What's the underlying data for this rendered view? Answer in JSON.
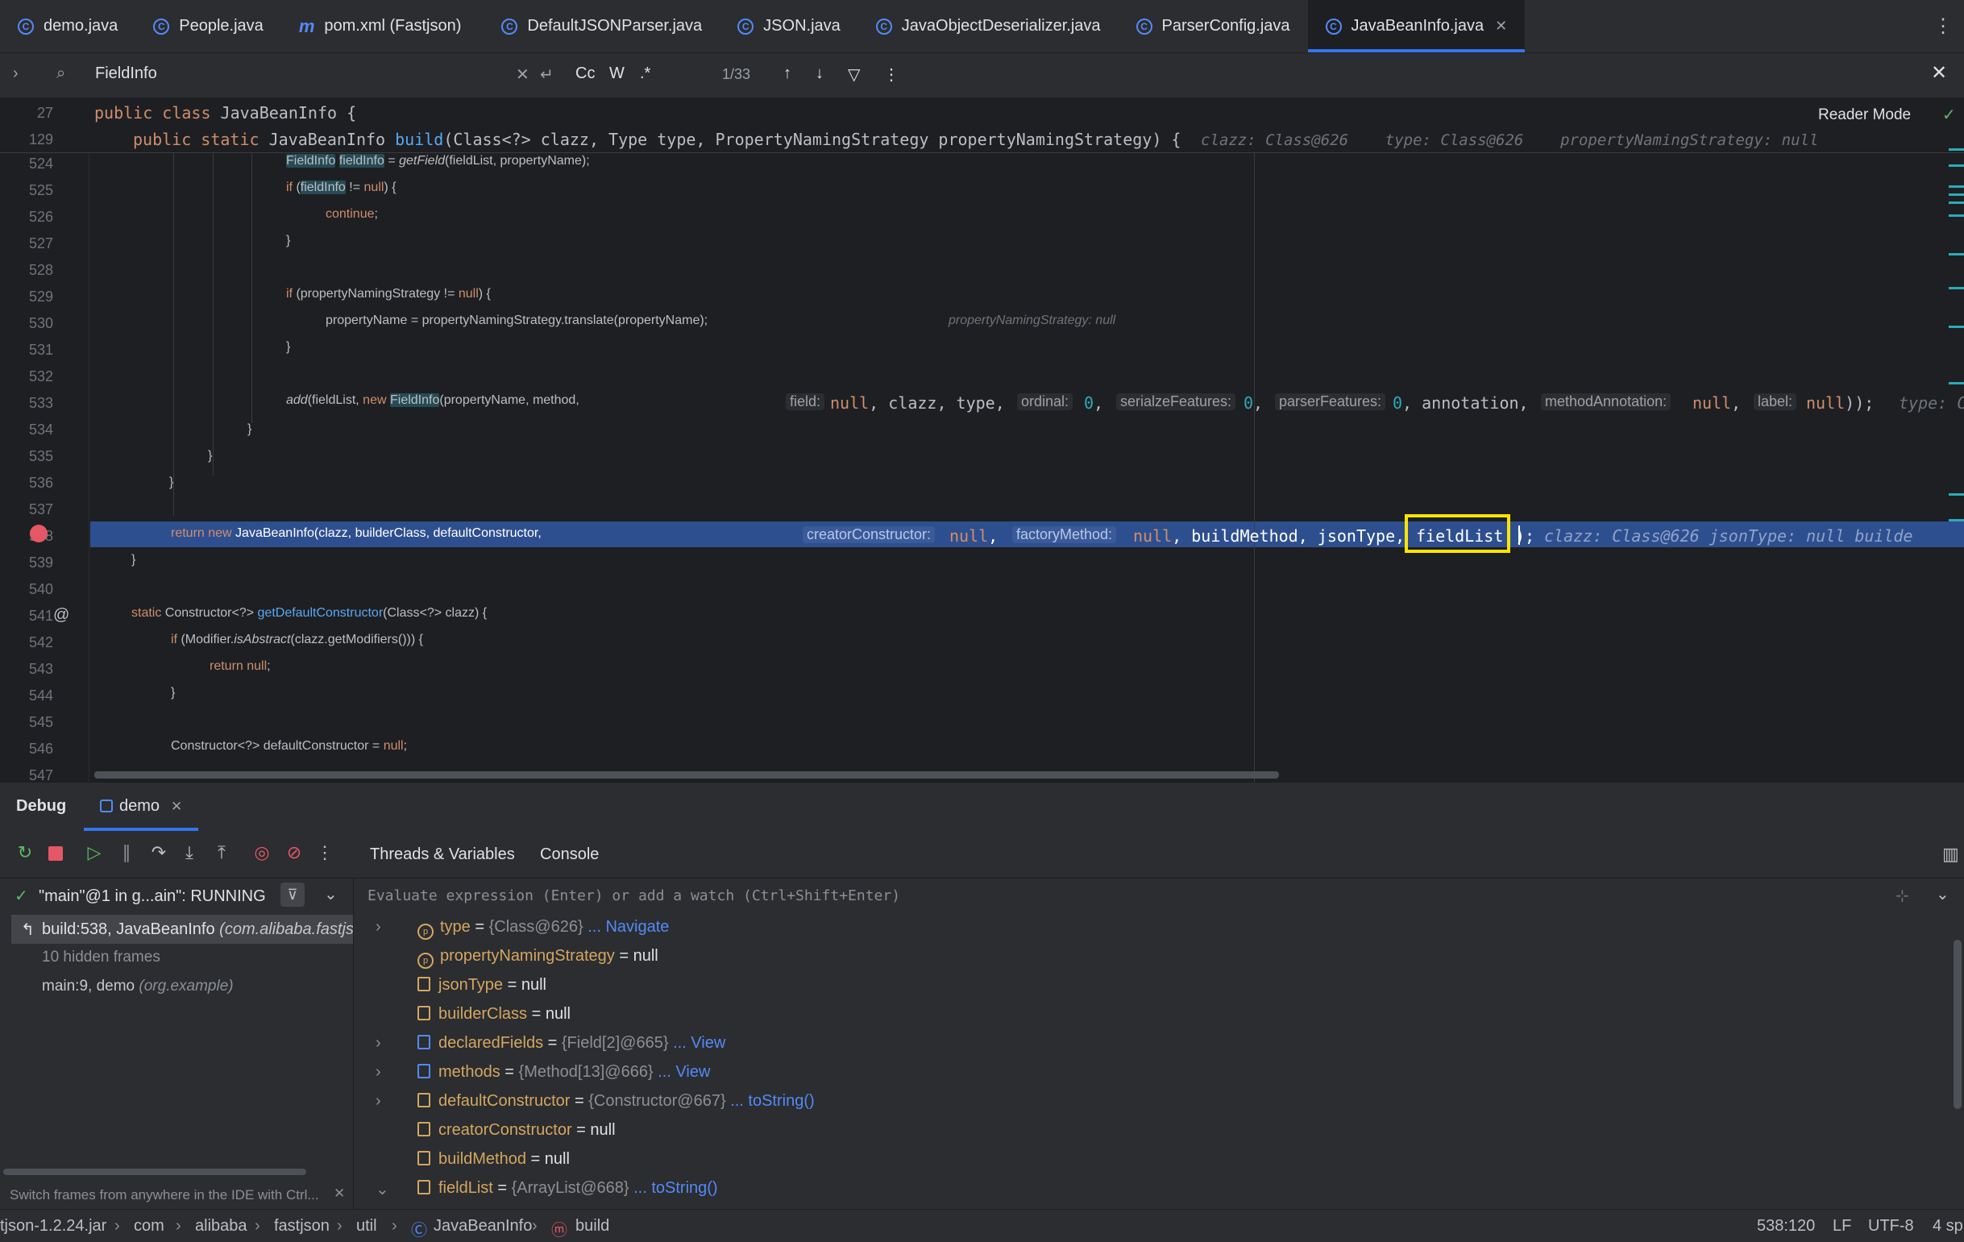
{
  "tabs": [
    {
      "label": "demo.java",
      "icon": "java-class-icon"
    },
    {
      "label": "People.java",
      "icon": "java-class-icon"
    },
    {
      "label": "pom.xml (Fastjson)",
      "icon": "maven-icon"
    },
    {
      "label": "DefaultJSONParser.java",
      "icon": "java-class-icon"
    },
    {
      "label": "JSON.java",
      "icon": "java-class-icon"
    },
    {
      "label": "JavaObjectDeserializer.java",
      "icon": "java-class-icon"
    },
    {
      "label": "ParserConfig.java",
      "icon": "java-class-icon"
    },
    {
      "label": "JavaBeanInfo.java",
      "icon": "java-class-icon",
      "active": true
    }
  ],
  "find": {
    "query": "FieldInfo",
    "match_count": "1/33",
    "cc": "Cc",
    "w": "W",
    "regex": ".*"
  },
  "editor": {
    "reader_mode": "Reader Mode",
    "sticky": [
      {
        "line": "27",
        "text": "public class JavaBeanInfo {"
      },
      {
        "line": "129",
        "text": "public static JavaBeanInfo build(Class<?> clazz, Type type, PropertyNamingStrategy propertyNamingStrategy) {",
        "hint": "clazz: Class@626    type: Class@626    propertyNamingStrategy: null"
      }
    ],
    "line_numbers": [
      "524",
      "525",
      "526",
      "527",
      "528",
      "529",
      "530",
      "531",
      "532",
      "533",
      "534",
      "535",
      "536",
      "537",
      "538",
      "539",
      "540",
      "541",
      "542",
      "543",
      "544",
      "545",
      "546",
      "547"
    ],
    "hints": {
      "l530": "propertyNamingStrategy: null",
      "field": "field:",
      "ordinal": "ordinal:",
      "serialze": "serialzeFeatures:",
      "parser": "parserFeatures:",
      "methodAnn": "methodAnnotation:",
      "label": "label:",
      "l533_tail": "type: C",
      "creator": "creatorConstructor:",
      "factory": "factoryMethod:",
      "l538_tail": "clazz: Class@626    jsonType: null    builde"
    }
  },
  "debug": {
    "title": "Debug",
    "session": "demo",
    "tabs": [
      "Threads & Variables",
      "Console"
    ],
    "thread": "\"main\"@1 in g...ain\": RUNNING",
    "frames": [
      {
        "text": "build:538, JavaBeanInfo",
        "pkg": "(com.alibaba.fastjson"
      },
      {
        "text": "10 hidden frames",
        "pkg": ""
      },
      {
        "text": "main:9, demo",
        "pkg": "(org.example)"
      }
    ],
    "frames_hint": "Switch frames from anywhere in the IDE with Ctrl...",
    "eval_placeholder": "Evaluate expression (Enter) or add a watch (Ctrl+Shift+Enter)",
    "variables": [
      {
        "name": "type",
        "value": "{Class@626}",
        "link": "... Navigate",
        "expandable": "collapsed",
        "kind": "param"
      },
      {
        "name": "propertyNamingStrategy",
        "value": "null",
        "link": "",
        "expandable": "",
        "kind": "param"
      },
      {
        "name": "jsonType",
        "value": "null",
        "link": "",
        "expandable": "",
        "kind": "local"
      },
      {
        "name": "builderClass",
        "value": "null",
        "link": "",
        "expandable": "",
        "kind": "local"
      },
      {
        "name": "declaredFields",
        "value": "{Field[2]@665}",
        "link": "... View",
        "expandable": "collapsed",
        "kind": "array"
      },
      {
        "name": "methods",
        "value": "{Method[13]@666}",
        "link": "... View",
        "expandable": "collapsed",
        "kind": "array"
      },
      {
        "name": "defaultConstructor",
        "value": "{Constructor@667}",
        "link": "... toString()",
        "expandable": "collapsed",
        "kind": "local"
      },
      {
        "name": "creatorConstructor",
        "value": "null",
        "link": "",
        "expandable": "",
        "kind": "local"
      },
      {
        "name": "buildMethod",
        "value": "null",
        "link": "",
        "expandable": "",
        "kind": "local"
      },
      {
        "name": "fieldList",
        "value": "{ArrayList@668}",
        "link": "... toString()",
        "expandable": "expanded",
        "kind": "local"
      }
    ]
  },
  "status": {
    "breadcrumb": [
      "tjson-1.2.24.jar",
      "com",
      "alibaba",
      "fastjson",
      "util",
      "JavaBeanInfo",
      "build"
    ],
    "position": "538:120",
    "line_sep": "LF",
    "encoding": "UTF-8",
    "indent": "4 sp"
  },
  "colors": {
    "accent": "#3574f0",
    "highlight_box": "#ffe400",
    "current_line": "#2e4f8f"
  }
}
